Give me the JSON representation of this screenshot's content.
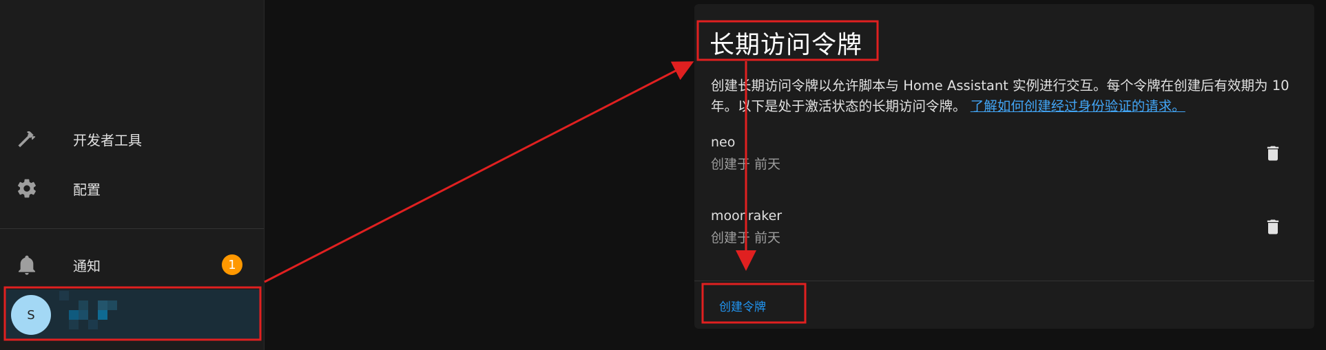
{
  "sidebar": {
    "items": [
      {
        "label": "开发者工具",
        "icon": "hammer-icon"
      },
      {
        "label": "配置",
        "icon": "gear-icon"
      },
      {
        "label": "通知",
        "icon": "bell-icon"
      }
    ],
    "notification_count": "1",
    "user": {
      "avatar_initial": "S"
    }
  },
  "card": {
    "title": "长期访问令牌",
    "description": "创建长期访问令牌以允许脚本与 Home Assistant 实例进行交互。每个令牌在创建后有效期为 10 年。以下是处于激活状态的长期访问令牌。",
    "learn_link": "了解如何创建经过身份验证的请求。",
    "tokens": [
      {
        "name": "neo",
        "created": "创建于 前天"
      },
      {
        "name": "moonraker",
        "created": "创建于 前天"
      }
    ],
    "create_button": "创建令牌"
  },
  "colors": {
    "accent": "#2196f3",
    "link": "#42a5f5",
    "badge": "#ff9800",
    "annotation": "#e02020"
  }
}
